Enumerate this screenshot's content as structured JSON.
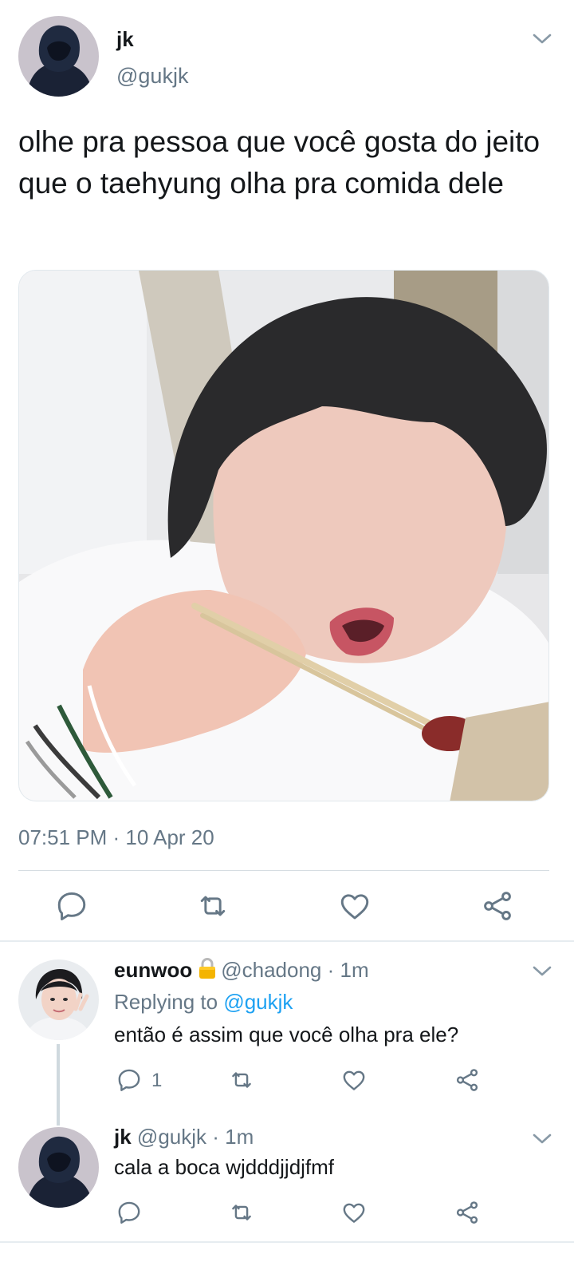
{
  "main_tweet": {
    "author_name": "jk",
    "author_handle": "@gukjk",
    "text": "olhe pra pessoa que você gosta do jeito que o taehyung olha pra comida dele",
    "timestamp": "07:51 PM · 10 Apr 20"
  },
  "replies": [
    {
      "author_name": "eunwoo",
      "protected_icon": "lock-icon",
      "author_handle": "@chadong",
      "separator": " · ",
      "time": "1m",
      "replying_prefix": "Replying to ",
      "replying_handle": "@gukjk",
      "text": "então é assim que você olha pra ele?",
      "reply_count": "1"
    },
    {
      "author_name": "jk",
      "author_handle": "@gukjk",
      "separator": " · ",
      "time": "1m",
      "text": "cala a boca wjdddjjdjfmf"
    }
  ],
  "icons": [
    "chevron-down-icon",
    "reply-icon",
    "retweet-icon",
    "like-icon",
    "share-icon",
    "lock-icon"
  ],
  "colors": {
    "text": "#14171a",
    "muted": "#657786",
    "link": "#1da1f2",
    "icon": "#657786"
  }
}
